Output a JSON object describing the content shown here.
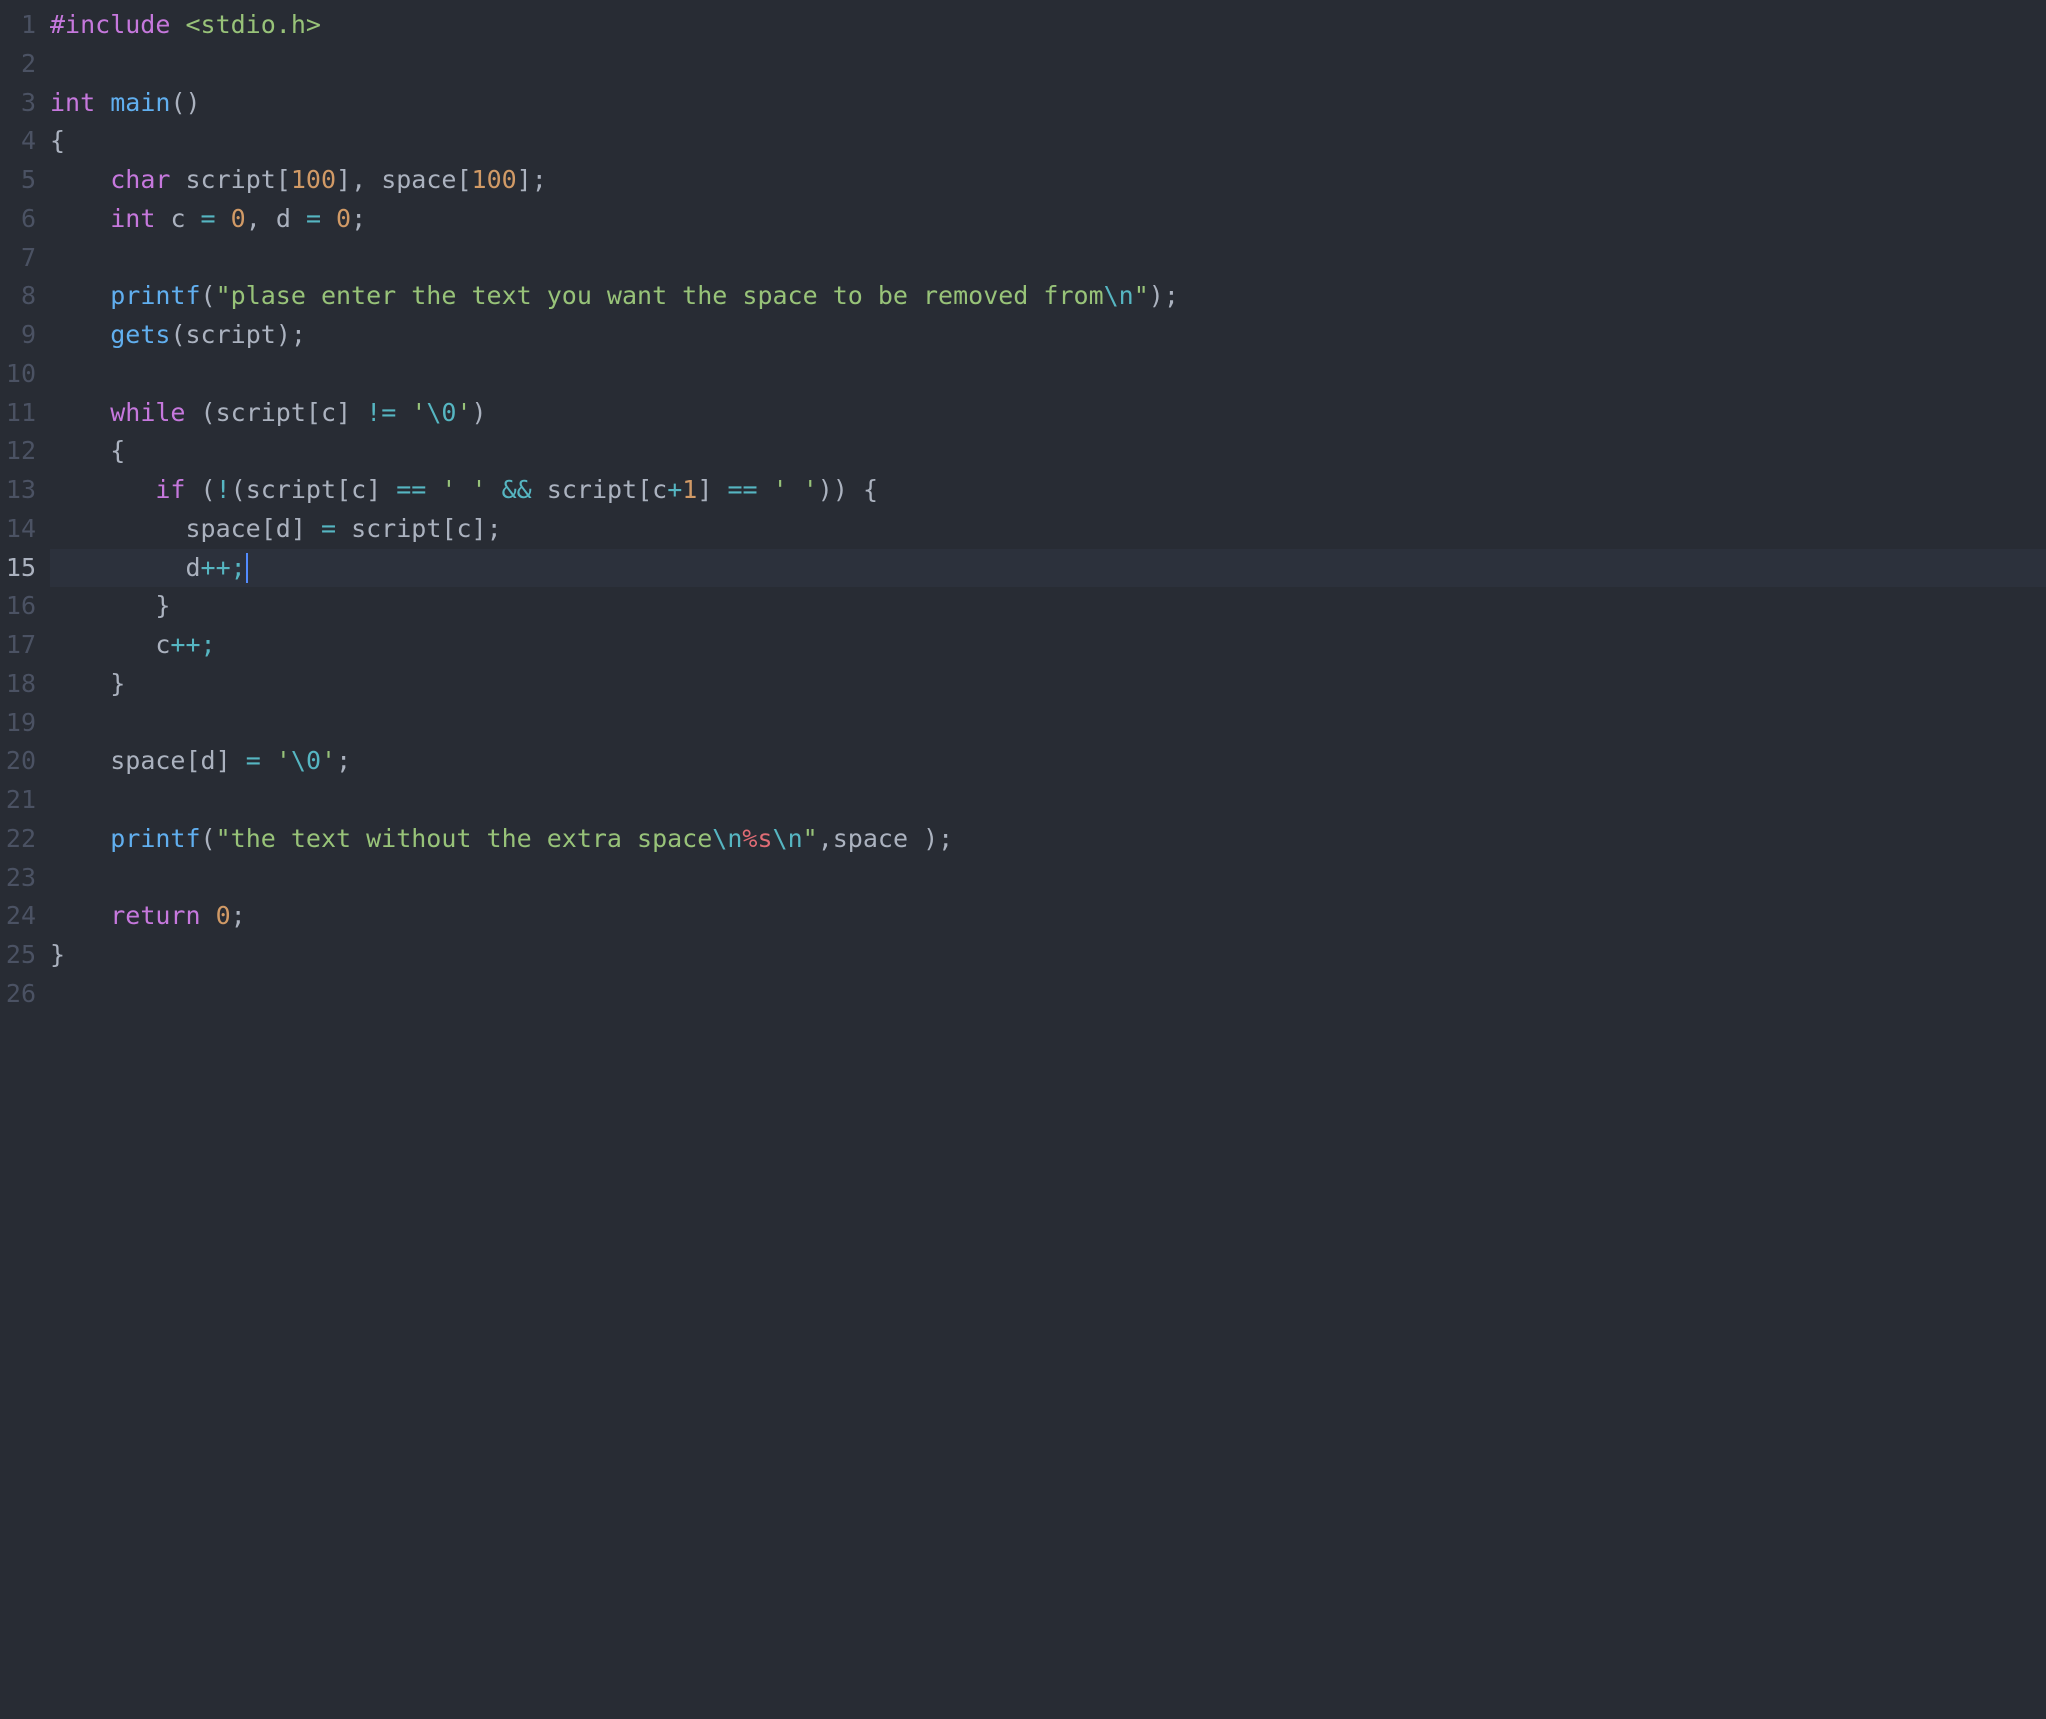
{
  "editor": {
    "active_line": 15,
    "cursor_after_token_index": 2,
    "lines": [
      {
        "n": 1,
        "tokens": [
          {
            "t": "#include ",
            "c": "tok-pre"
          },
          {
            "t": "<stdio.h>",
            "c": "tok-inc"
          }
        ]
      },
      {
        "n": 2,
        "tokens": []
      },
      {
        "n": 3,
        "tokens": [
          {
            "t": "int ",
            "c": "tok-type"
          },
          {
            "t": "main",
            "c": "tok-fn"
          },
          {
            "t": "()",
            "c": "tok-paren"
          }
        ]
      },
      {
        "n": 4,
        "tokens": [
          {
            "t": "{",
            "c": "tok-brace"
          }
        ]
      },
      {
        "n": 5,
        "tokens": [
          {
            "t": "    ",
            "c": ""
          },
          {
            "t": "char ",
            "c": "tok-type"
          },
          {
            "t": "script",
            "c": "tok-var"
          },
          {
            "t": "[",
            "c": "tok-brack"
          },
          {
            "t": "100",
            "c": "tok-num"
          },
          {
            "t": "]",
            "c": "tok-brack"
          },
          {
            "t": ", ",
            "c": "tok-punc"
          },
          {
            "t": "space",
            "c": "tok-var"
          },
          {
            "t": "[",
            "c": "tok-brack"
          },
          {
            "t": "100",
            "c": "tok-num"
          },
          {
            "t": "]",
            "c": "tok-brack"
          },
          {
            "t": ";",
            "c": "tok-punc"
          }
        ]
      },
      {
        "n": 6,
        "tokens": [
          {
            "t": "    ",
            "c": ""
          },
          {
            "t": "int ",
            "c": "tok-type"
          },
          {
            "t": "c ",
            "c": "tok-var"
          },
          {
            "t": "= ",
            "c": "tok-op"
          },
          {
            "t": "0",
            "c": "tok-num"
          },
          {
            "t": ", ",
            "c": "tok-punc"
          },
          {
            "t": "d ",
            "c": "tok-var"
          },
          {
            "t": "= ",
            "c": "tok-op"
          },
          {
            "t": "0",
            "c": "tok-num"
          },
          {
            "t": ";",
            "c": "tok-punc"
          }
        ]
      },
      {
        "n": 7,
        "tokens": []
      },
      {
        "n": 8,
        "tokens": [
          {
            "t": "    ",
            "c": ""
          },
          {
            "t": "printf",
            "c": "tok-fn"
          },
          {
            "t": "(",
            "c": "tok-paren"
          },
          {
            "t": "\"plase enter the text you want the space to be removed from",
            "c": "tok-str"
          },
          {
            "t": "\\n",
            "c": "tok-esc"
          },
          {
            "t": "\"",
            "c": "tok-str"
          },
          {
            "t": ")",
            "c": "tok-paren"
          },
          {
            "t": ";",
            "c": "tok-punc"
          }
        ]
      },
      {
        "n": 9,
        "tokens": [
          {
            "t": "    ",
            "c": ""
          },
          {
            "t": "gets",
            "c": "tok-fn"
          },
          {
            "t": "(",
            "c": "tok-paren"
          },
          {
            "t": "script",
            "c": "tok-var"
          },
          {
            "t": ")",
            "c": "tok-paren"
          },
          {
            "t": ";",
            "c": "tok-punc"
          }
        ]
      },
      {
        "n": 10,
        "tokens": []
      },
      {
        "n": 11,
        "tokens": [
          {
            "t": "    ",
            "c": ""
          },
          {
            "t": "while ",
            "c": "tok-kw"
          },
          {
            "t": "(",
            "c": "tok-paren"
          },
          {
            "t": "script",
            "c": "tok-var"
          },
          {
            "t": "[",
            "c": "tok-brack"
          },
          {
            "t": "c",
            "c": "tok-var"
          },
          {
            "t": "]",
            "c": "tok-brack"
          },
          {
            "t": " != ",
            "c": "tok-op"
          },
          {
            "t": "'",
            "c": "tok-str"
          },
          {
            "t": "\\0",
            "c": "tok-esc"
          },
          {
            "t": "'",
            "c": "tok-str"
          },
          {
            "t": ")",
            "c": "tok-paren"
          }
        ]
      },
      {
        "n": 12,
        "tokens": [
          {
            "t": "    ",
            "c": ""
          },
          {
            "t": "{",
            "c": "tok-brace"
          }
        ]
      },
      {
        "n": 13,
        "tokens": [
          {
            "t": "       ",
            "c": ""
          },
          {
            "t": "if ",
            "c": "tok-kw"
          },
          {
            "t": "(",
            "c": "tok-paren"
          },
          {
            "t": "!",
            "c": "tok-op"
          },
          {
            "t": "(",
            "c": "tok-paren"
          },
          {
            "t": "script",
            "c": "tok-var"
          },
          {
            "t": "[",
            "c": "tok-brack"
          },
          {
            "t": "c",
            "c": "tok-var"
          },
          {
            "t": "]",
            "c": "tok-brack"
          },
          {
            "t": " == ",
            "c": "tok-op"
          },
          {
            "t": "' '",
            "c": "tok-str"
          },
          {
            "t": " && ",
            "c": "tok-op"
          },
          {
            "t": "script",
            "c": "tok-var"
          },
          {
            "t": "[",
            "c": "tok-brack"
          },
          {
            "t": "c",
            "c": "tok-var"
          },
          {
            "t": "+",
            "c": "tok-op"
          },
          {
            "t": "1",
            "c": "tok-num"
          },
          {
            "t": "]",
            "c": "tok-brack"
          },
          {
            "t": " == ",
            "c": "tok-op"
          },
          {
            "t": "' '",
            "c": "tok-str"
          },
          {
            "t": "))",
            "c": "tok-paren"
          },
          {
            "t": " {",
            "c": "tok-brace"
          }
        ]
      },
      {
        "n": 14,
        "tokens": [
          {
            "t": "         ",
            "c": ""
          },
          {
            "t": "space",
            "c": "tok-var"
          },
          {
            "t": "[",
            "c": "tok-brack"
          },
          {
            "t": "d",
            "c": "tok-var"
          },
          {
            "t": "]",
            "c": "tok-brack"
          },
          {
            "t": " = ",
            "c": "tok-op"
          },
          {
            "t": "script",
            "c": "tok-var"
          },
          {
            "t": "[",
            "c": "tok-brack"
          },
          {
            "t": "c",
            "c": "tok-var"
          },
          {
            "t": "]",
            "c": "tok-brack"
          },
          {
            "t": ";",
            "c": "tok-punc"
          }
        ]
      },
      {
        "n": 15,
        "tokens": [
          {
            "t": "         ",
            "c": ""
          },
          {
            "t": "d",
            "c": "tok-var"
          },
          {
            "t": "++;",
            "c": "tok-op"
          }
        ]
      },
      {
        "n": 16,
        "tokens": [
          {
            "t": "       ",
            "c": ""
          },
          {
            "t": "}",
            "c": "tok-brace"
          }
        ]
      },
      {
        "n": 17,
        "tokens": [
          {
            "t": "       ",
            "c": ""
          },
          {
            "t": "c",
            "c": "tok-var"
          },
          {
            "t": "++;",
            "c": "tok-op"
          }
        ]
      },
      {
        "n": 18,
        "tokens": [
          {
            "t": "    ",
            "c": ""
          },
          {
            "t": "}",
            "c": "tok-brace"
          }
        ]
      },
      {
        "n": 19,
        "tokens": []
      },
      {
        "n": 20,
        "tokens": [
          {
            "t": "    ",
            "c": ""
          },
          {
            "t": "space",
            "c": "tok-var"
          },
          {
            "t": "[",
            "c": "tok-brack"
          },
          {
            "t": "d",
            "c": "tok-var"
          },
          {
            "t": "]",
            "c": "tok-brack"
          },
          {
            "t": " = ",
            "c": "tok-op"
          },
          {
            "t": "'",
            "c": "tok-str"
          },
          {
            "t": "\\0",
            "c": "tok-esc"
          },
          {
            "t": "'",
            "c": "tok-str"
          },
          {
            "t": ";",
            "c": "tok-punc"
          }
        ]
      },
      {
        "n": 21,
        "tokens": []
      },
      {
        "n": 22,
        "tokens": [
          {
            "t": "    ",
            "c": ""
          },
          {
            "t": "printf",
            "c": "tok-fn"
          },
          {
            "t": "(",
            "c": "tok-paren"
          },
          {
            "t": "\"the text without the extra space",
            "c": "tok-str"
          },
          {
            "t": "\\n",
            "c": "tok-esc"
          },
          {
            "t": "%s",
            "c": "tok-red"
          },
          {
            "t": "\\n",
            "c": "tok-esc"
          },
          {
            "t": "\"",
            "c": "tok-str"
          },
          {
            "t": ",",
            "c": "tok-punc"
          },
          {
            "t": "space ",
            "c": "tok-var"
          },
          {
            "t": ")",
            "c": "tok-paren"
          },
          {
            "t": ";",
            "c": "tok-punc"
          }
        ]
      },
      {
        "n": 23,
        "tokens": []
      },
      {
        "n": 24,
        "tokens": [
          {
            "t": "    ",
            "c": ""
          },
          {
            "t": "return ",
            "c": "tok-kw"
          },
          {
            "t": "0",
            "c": "tok-num"
          },
          {
            "t": ";",
            "c": "tok-punc"
          }
        ]
      },
      {
        "n": 25,
        "tokens": [
          {
            "t": "}",
            "c": "tok-brace"
          }
        ]
      },
      {
        "n": 26,
        "tokens": []
      }
    ]
  }
}
